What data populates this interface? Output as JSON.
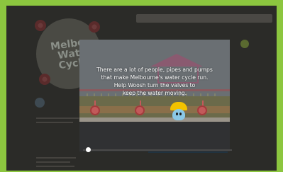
{
  "page": {
    "background_color": "#8cc63f"
  },
  "background": {
    "logo_lines": [
      "Melbo",
      "Wat",
      "Cycl"
    ]
  },
  "video": {
    "caption_lines": [
      "There are a lot of people, pipes and pumps",
      "that make Melbourne's water cycle run.",
      "Help Woosh turn the valves to",
      "keep the water moving."
    ],
    "progress": 0.02
  },
  "colors": {
    "valve": "#c25a5a",
    "woosh_hat": "#f2c200",
    "woosh_body": "#8ac8e6"
  }
}
